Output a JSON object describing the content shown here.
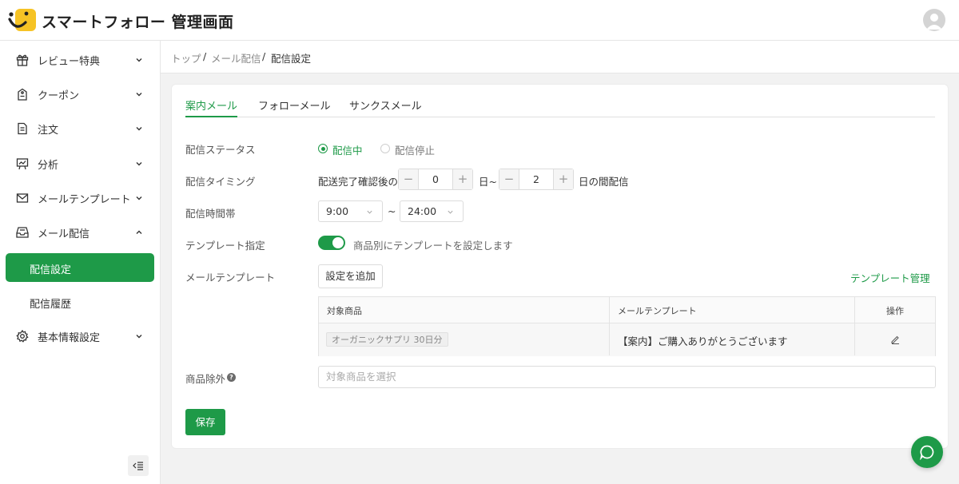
{
  "header": {
    "title": "スマートフォロー 管理画面",
    "logo_icon": "smiley-logo",
    "avatar_icon": "user-avatar"
  },
  "sidebar": {
    "items": [
      {
        "label": "レビュー特典",
        "icon": "gift-icon",
        "expanded": false
      },
      {
        "label": "クーポン",
        "icon": "coupon-icon",
        "expanded": false
      },
      {
        "label": "注文",
        "icon": "document-icon",
        "expanded": false
      },
      {
        "label": "分析",
        "icon": "chart-board-icon",
        "expanded": false
      },
      {
        "label": "メールテンプレート",
        "icon": "mail-icon",
        "expanded": false
      },
      {
        "label": "メール配信",
        "icon": "inbox-icon",
        "expanded": true,
        "children": [
          {
            "label": "配信設定",
            "active": true
          },
          {
            "label": "配信履歴",
            "active": false
          }
        ]
      },
      {
        "label": "基本情報設定",
        "icon": "gear-icon",
        "expanded": false
      }
    ],
    "collapse_icon": "collapse-sidebar-icon"
  },
  "breadcrumb": {
    "items": [
      "トップ",
      "メール配信",
      "配信設定"
    ],
    "separator": "/"
  },
  "tabs": [
    {
      "label": "案内メール",
      "active": true
    },
    {
      "label": "フォローメール",
      "active": false
    },
    {
      "label": "サンクスメール",
      "active": false
    }
  ],
  "form": {
    "status": {
      "label": "配信ステータス",
      "options": [
        "配信中",
        "配信停止"
      ],
      "selected": "配信中"
    },
    "timing": {
      "label": "配信タイミング",
      "prefix": "配送完了確認後の",
      "from_value": "0",
      "middle": "日~",
      "to_value": "2",
      "suffix": "日の間配信",
      "minus_glyph": "−",
      "plus_glyph": "+"
    },
    "time_window": {
      "label": "配信時間帯",
      "start": "9:00",
      "separator": "~",
      "end": "24:00"
    },
    "template_assign": {
      "label": "テンプレート指定",
      "enabled": true,
      "description": "商品別にテンプレートを設定します"
    },
    "mail_template": {
      "label": "メールテンプレート",
      "add_button": "設定を追加",
      "manage_link": "テンプレート管理",
      "columns": [
        "対象商品",
        "メールテンプレート",
        "操作"
      ],
      "rows": [
        {
          "product": "オーガニックサプリ 30日分",
          "template": "【案内】ご購入ありがとうございます",
          "action_icon": "edit-icon"
        }
      ]
    },
    "exclude": {
      "label": "商品除外",
      "help_glyph": "?",
      "placeholder": "対象商品を選択"
    },
    "save_button": "保存"
  },
  "colors": {
    "accent": "#1e9a48",
    "text": "#333333",
    "muted": "#888888",
    "background": "#f2f2f2"
  },
  "chat_icon": "chat-bubble-icon"
}
